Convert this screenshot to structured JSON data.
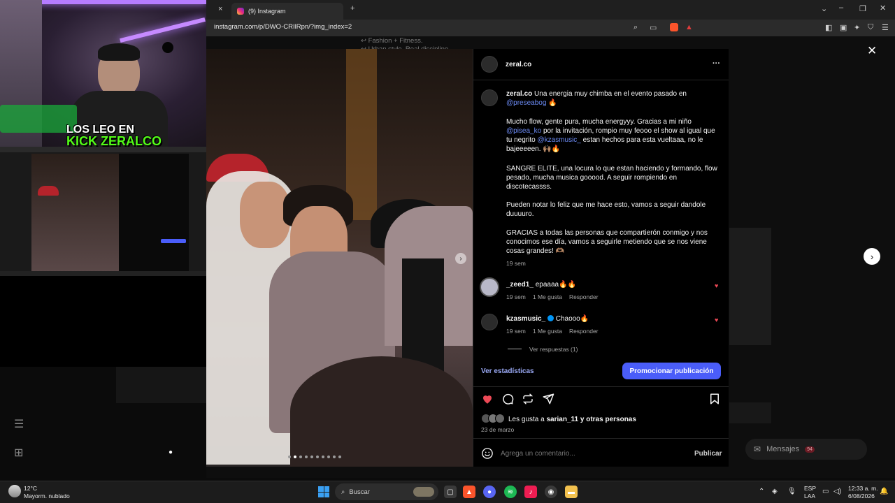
{
  "browser": {
    "tab_title": "(9) Instagram",
    "url": "instagram.com/p/DWO-CRIlRpn/?img_index=2",
    "close_tab_glyph": "×",
    "new_tab_glyph": "+"
  },
  "stream_overlay": {
    "caption_line1": "LOS LEO EN",
    "caption_line2": "KICK ZERALCO",
    "neon_color": "#9b59ff"
  },
  "background_page": {
    "line1": "↩ Fashion + Fitness.",
    "line2": "↩ Urban style. Real discipline.",
    "messages_label": "Mensajes",
    "messages_badge": "94"
  },
  "post": {
    "author": "zeral.co",
    "more_glyph": "···",
    "caption": {
      "author": "zeral.co",
      "p1_text": "Una energia muy chimba en el evento pasado en",
      "p1_mention": "@preseabog",
      "p1_emoji": "🔥",
      "p2_a": "Mucho flow, gente pura, mucha energyyy. Gracias a mi niño",
      "p2_mention1": "@pisea_ko",
      "p2_b": "por la invitación, rompio muy feooo el show al igual que tu negrito",
      "p2_mention2": "@kzasmusic_",
      "p2_c": "estan hechos para esta vueltaaa, no le bajeeeeen. 🙌🏽🔥",
      "p3": "SANGRE ELITE, una locura lo que estan haciendo y formando, flow pesado, mucha musica gooood. A seguir rompiendo en discotecassss.",
      "p4": "Pueden notar lo feliz que me hace esto, vamos a seguir dandole duuuuro.",
      "p5": "GRACIAS a todas las personas que compartierón conmigo y nos conocimos ese día, vamos a seguirle metiendo que se nos viene cosas grandes! 🫶🏽",
      "time": "19 sem"
    },
    "comments": [
      {
        "user": "_zeed1_",
        "verified": false,
        "text": "epaaaa🔥🔥",
        "time": "19 sem",
        "likes": "1 Me gusta",
        "reply": "Responder"
      },
      {
        "user": "kzasmusic_",
        "verified": true,
        "text": "Chaooo🔥",
        "time": "19 sem",
        "likes": "1 Me gusta",
        "reply": "Responder"
      }
    ],
    "view_replies": "Ver respuestas (1)",
    "stats_link": "Ver estadísticas",
    "promote_button": "Promocionar publicación",
    "likes_text_prefix": "Les gusta a",
    "likes_user": "sarian_11",
    "likes_suffix": "y otras personas",
    "date": "23 de marzo",
    "comment_placeholder": "Agrega un comentario...",
    "publish": "Publicar",
    "carousel_index": 2,
    "carousel_total": 10,
    "colors": {
      "like": "#ed4956",
      "accent": "#4a5df9",
      "link": "#6c8bf5"
    }
  },
  "taskbar": {
    "weather_temp": "12°C",
    "weather_desc": "Mayorm. nublado",
    "search_label": "Buscar",
    "lang_top": "ESP",
    "lang_bottom": "LAA",
    "time": "12:33 a. m.",
    "date": "6/08/2026"
  }
}
